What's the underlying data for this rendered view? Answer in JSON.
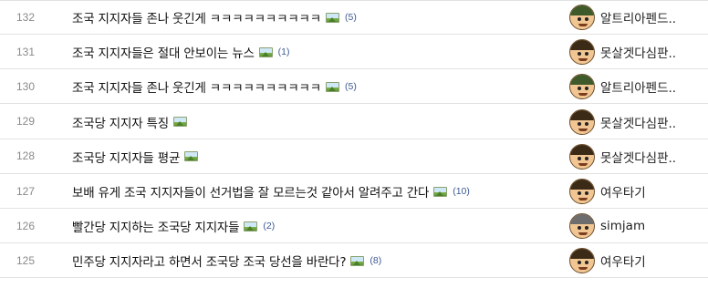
{
  "posts": [
    {
      "num": "132",
      "title": "조국 지지자들 존나 웃긴게 ㅋㅋㅋㅋㅋㅋㅋㅋㅋㅋ",
      "has_image": true,
      "comments": "(5)",
      "author": "알트리아펜드..",
      "avatar": "green"
    },
    {
      "num": "131",
      "title": "조국 지지자들은 절대 안보이는 뉴스",
      "has_image": true,
      "comments": "(1)",
      "author": "못살겟다심판..",
      "avatar": "brown"
    },
    {
      "num": "130",
      "title": "조국 지지자들 존나 웃긴게 ㅋㅋㅋㅋㅋㅋㅋㅋㅋㅋ",
      "has_image": true,
      "comments": "(5)",
      "author": "알트리아펜드..",
      "avatar": "green"
    },
    {
      "num": "129",
      "title": "조국당 지지자 특징",
      "has_image": true,
      "comments": "",
      "author": "못살겟다심판..",
      "avatar": "brown"
    },
    {
      "num": "128",
      "title": "조국당 지지자들 평균",
      "has_image": true,
      "comments": "",
      "author": "못살겟다심판..",
      "avatar": "brown"
    },
    {
      "num": "127",
      "title": "보배 유게 조국 지지자들이 선거법을 잘 모르는것 같아서 알려주고 간다",
      "has_image": true,
      "comments": "(10)",
      "author": "여우타기",
      "avatar": "brown"
    },
    {
      "num": "126",
      "title": "빨간당 지지하는 조국당 지지자들",
      "has_image": true,
      "comments": "(2)",
      "author": "simjam",
      "avatar": "gray"
    },
    {
      "num": "125",
      "title": "민주당 지지자라고 하면서 조국당 조국 당선을 바란다?",
      "has_image": true,
      "comments": "(8)",
      "author": "여우타기",
      "avatar": "brown"
    }
  ]
}
